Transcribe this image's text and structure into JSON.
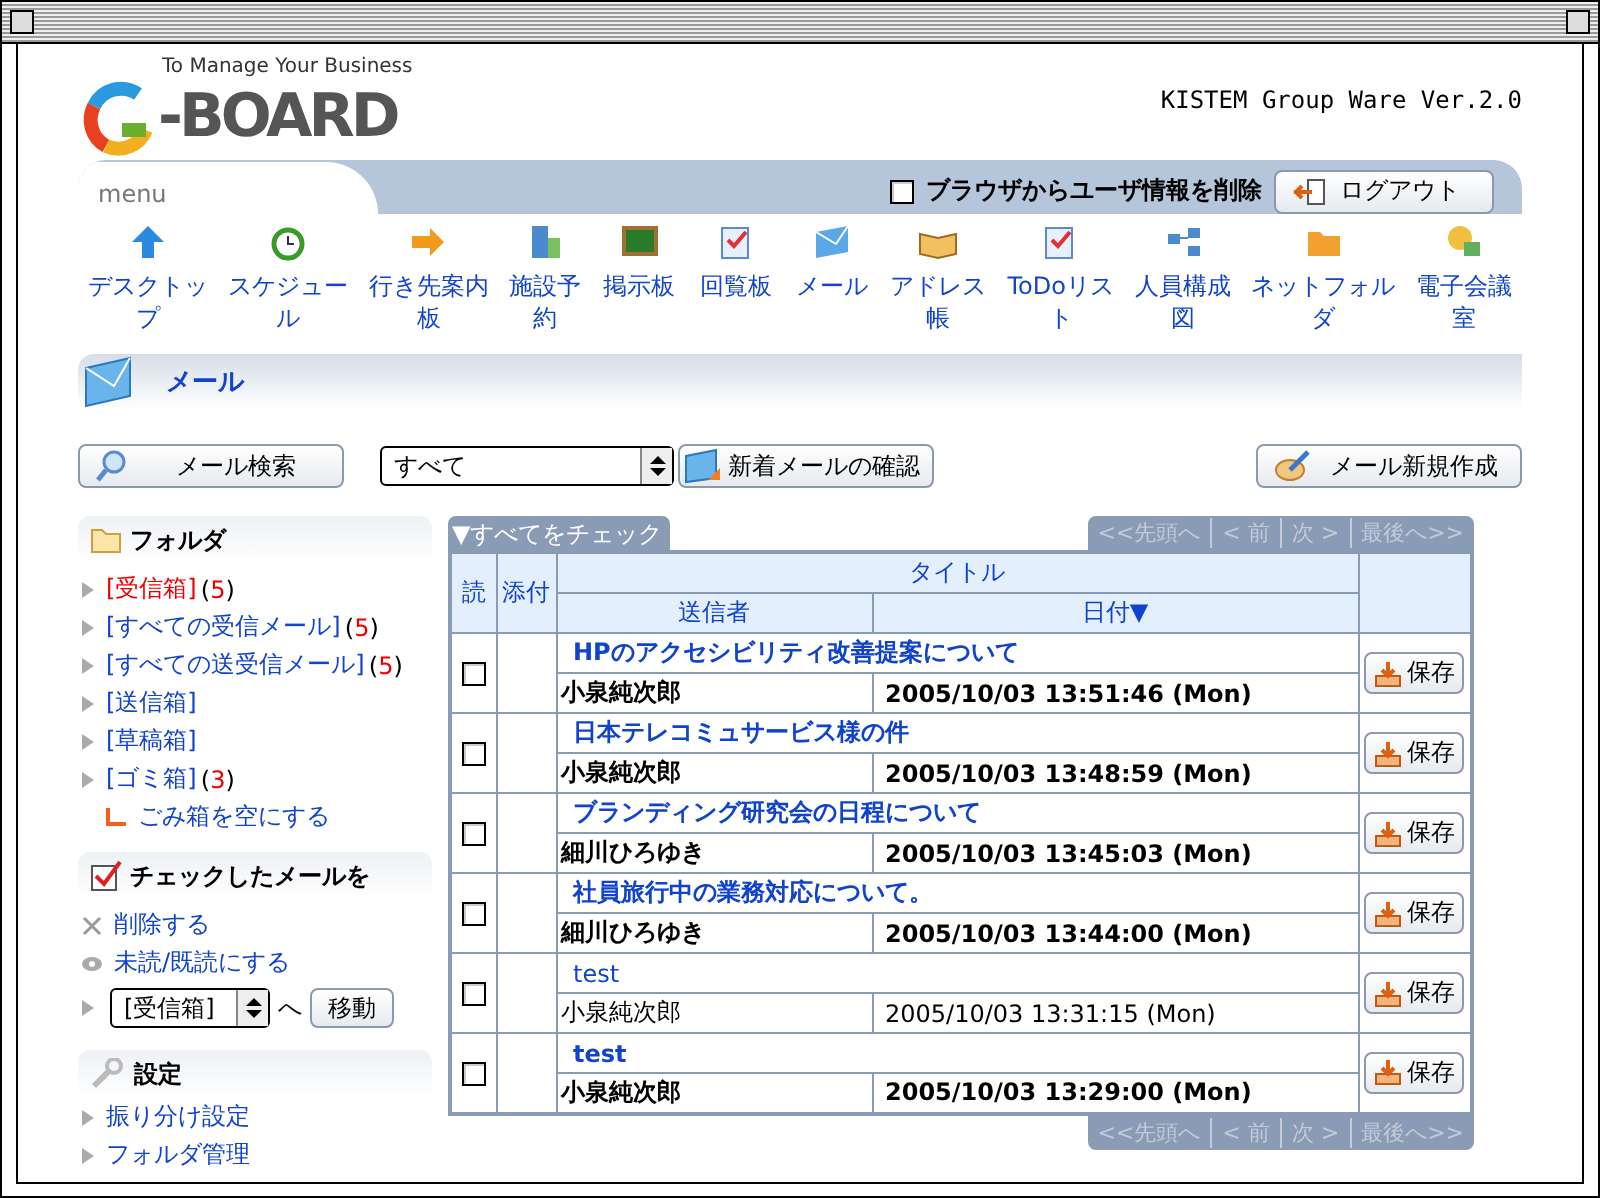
{
  "header": {
    "tagline": "To Manage Your Business",
    "logo_text": "-BOARD",
    "version": "KISTEM Group Ware Ver.2.0"
  },
  "menu": {
    "tab": "menu",
    "clear_label": "ブラウザからユーザ情報を削除",
    "clear_checked": false,
    "logout": "ログアウト",
    "items": [
      {
        "label": "デスクトップ"
      },
      {
        "label": "スケジュール"
      },
      {
        "label": "行き先案内板"
      },
      {
        "label": "施設予約"
      },
      {
        "label": "掲示板"
      },
      {
        "label": "回覧板"
      },
      {
        "label": "メール"
      },
      {
        "label": "アドレス帳"
      },
      {
        "label": "ToDoリスト"
      },
      {
        "label": "人員構成図"
      },
      {
        "label": "ネットフォルダ"
      },
      {
        "label": "電子会議室"
      }
    ]
  },
  "section": {
    "title": "メール"
  },
  "toolbar": {
    "search": "メール検索",
    "filter": "すべて",
    "check_new": "新着メールの確認",
    "compose": "メール新規作成"
  },
  "folders": {
    "title": "フォルダ",
    "items": [
      {
        "label": "[受信箱]",
        "count": "(5)",
        "selected": true
      },
      {
        "label": "[すべての受信メール]",
        "count": "(5)",
        "selected": false
      },
      {
        "label": "[すべての送受信メール]",
        "count": "(5)",
        "selected": false
      },
      {
        "label": "[送信箱]",
        "selected": false
      },
      {
        "label": "[草稿箱]",
        "selected": false
      },
      {
        "label": "[ゴミ箱]",
        "count": "(3)",
        "selected": false
      }
    ],
    "empty_trash": "ごみ箱を空にする"
  },
  "actions": {
    "title": "チェックしたメールを",
    "delete": "削除する",
    "toggle_read": "未読/既読にする",
    "move_target": "[受信箱]",
    "move_to": "へ",
    "move": "移動"
  },
  "settings": {
    "title": "設定",
    "items": [
      "振り分け設定",
      "フォルダ管理"
    ]
  },
  "table": {
    "check_all": "▼すべてをチェック",
    "pager_top": [
      "<<先頭へ",
      "< 前",
      "次 >",
      "最後へ>>"
    ],
    "pager_bottom": [
      "<<先頭へ",
      "< 前",
      "次 >",
      "最後へ>>"
    ],
    "columns": {
      "read": "読",
      "attach": "添付",
      "title": "タイトル",
      "sender": "送信者",
      "date": "日付▼"
    },
    "rows": [
      {
        "title": "HPのアクセシビリティ改善提案について",
        "sender": "小泉純次郎",
        "date": "2005/10/03 13:51:46 (Mon)",
        "read": false,
        "checked": false,
        "save": "保存"
      },
      {
        "title": "日本テレコミュサービス様の件",
        "sender": "小泉純次郎",
        "date": "2005/10/03 13:48:59 (Mon)",
        "read": false,
        "checked": false,
        "save": "保存"
      },
      {
        "title": "ブランディング研究会の日程について",
        "sender": "細川ひろゆき",
        "date": "2005/10/03 13:45:03 (Mon)",
        "read": false,
        "checked": false,
        "save": "保存"
      },
      {
        "title": "社員旅行中の業務対応について。",
        "sender": "細川ひろゆき",
        "date": "2005/10/03 13:44:00 (Mon)",
        "read": false,
        "checked": false,
        "save": "保存"
      },
      {
        "title": "test",
        "sender": "小泉純次郎",
        "date": "2005/10/03 13:31:15 (Mon)",
        "read": true,
        "checked": false,
        "save": "保存"
      },
      {
        "title": "test",
        "sender": "小泉純次郎",
        "date": "2005/10/03 13:29:00 (Mon)",
        "read": false,
        "checked": false,
        "save": "保存"
      }
    ]
  }
}
